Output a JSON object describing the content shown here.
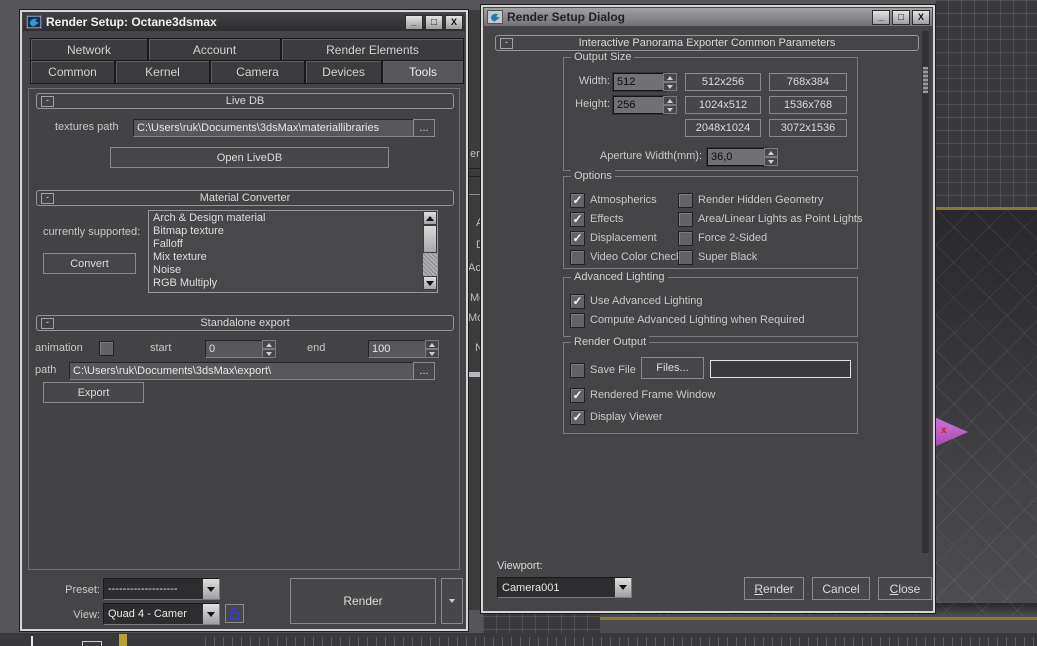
{
  "icons": {
    "minimize": "_",
    "maximize": "□",
    "close": "X",
    "collapse_minus": "-",
    "check": "✓",
    "gizmo_label": "x"
  },
  "colors": {
    "viewport_active_border": "#8c7a33",
    "gizmo_magenta": "#c45fc8",
    "lock_blue": "#3c3ccc",
    "dialog_bg": "#454547"
  },
  "left_dialog": {
    "title": "Render Setup: Octane3dsmax",
    "tabs_row1": [
      {
        "label": "Network"
      },
      {
        "label": "Account"
      },
      {
        "label": "Render Elements"
      }
    ],
    "tabs_row2": [
      {
        "label": "Common"
      },
      {
        "label": "Kernel"
      },
      {
        "label": "Camera"
      },
      {
        "label": "Devices"
      },
      {
        "label": "Tools"
      }
    ],
    "active_tab": "Tools",
    "live_db": {
      "title": "Live DB",
      "textures_path_label": "textures path",
      "textures_path_value": "C:\\Users\\ruk\\Documents\\3dsMax\\materiallibraries",
      "browse": "...",
      "open_button": "Open LiveDB"
    },
    "material_converter": {
      "title": "Material Converter",
      "supported_label": "currently supported:",
      "convert_button": "Convert",
      "items": [
        {
          "label": "Arch & Design material"
        },
        {
          "label": "Bitmap texture"
        },
        {
          "label": "Falloff"
        },
        {
          "label": "Mix texture"
        },
        {
          "label": "Noise"
        },
        {
          "label": "RGB Multiply"
        }
      ]
    },
    "standalone_export": {
      "title": "Standalone export",
      "animation_label": "animation",
      "start_label": "start",
      "start_value": "0",
      "end_label": "end",
      "end_value": "100",
      "path_label": "path",
      "path_value": "C:\\Users\\ruk\\Documents\\3dsMax\\export\\",
      "browse": "...",
      "export_button": "Export"
    },
    "footer": {
      "preset_label": "Preset:",
      "preset_value": "-------------------",
      "view_label": "View:",
      "view_value": "Quad 4 - Camer",
      "render_button": "Render"
    }
  },
  "right_dialog": {
    "title": "Render Setup Dialog",
    "rollup_title": "Interactive Panorama Exporter Common Parameters",
    "output_size": {
      "title": "Output Size",
      "width_label": "Width:",
      "width_value": "512",
      "height_label": "Height:",
      "height_value": "256",
      "aperture_label": "Aperture Width(mm):",
      "aperture_value": "36,0",
      "presets": [
        {
          "label": "512x256"
        },
        {
          "label": "768x384"
        },
        {
          "label": "1024x512"
        },
        {
          "label": "1536x768"
        },
        {
          "label": "2048x1024"
        },
        {
          "label": "3072x1536"
        }
      ]
    },
    "options": {
      "title": "Options",
      "left": [
        {
          "label": "Atmospherics",
          "check": "✓"
        },
        {
          "label": "Effects",
          "check": "✓"
        },
        {
          "label": "Displacement",
          "check": "✓"
        },
        {
          "label": "Video Color Check",
          "check": ""
        }
      ],
      "right": [
        {
          "label": "Render Hidden Geometry",
          "check": ""
        },
        {
          "label": "Area/Linear Lights as Point Lights",
          "check": ""
        },
        {
          "label": "Force 2-Sided",
          "check": ""
        },
        {
          "label": "Super Black",
          "check": ""
        }
      ]
    },
    "advanced_lighting": {
      "title": "Advanced Lighting",
      "items": [
        {
          "label": "Use Advanced Lighting",
          "check": "✓"
        },
        {
          "label": "Compute Advanced Lighting when Required",
          "check": ""
        }
      ]
    },
    "render_output": {
      "title": "Render Output",
      "save_file": {
        "label": "Save File",
        "check": ""
      },
      "files_button": "Files...",
      "output_field_value": "",
      "items": [
        {
          "label": "Rendered Frame Window",
          "check": "✓"
        },
        {
          "label": "Display Viewer",
          "check": "✓"
        }
      ]
    },
    "footer": {
      "viewport_label": "Viewport:",
      "viewport_value": "Camera001",
      "render_initial": "R",
      "render_rest": "ender",
      "cancel": "Cancel",
      "close_initial": "C",
      "close_rest": "lose"
    }
  },
  "background": {
    "fragments": [
      {
        "text": "er P"
      },
      {
        "text": "A"
      },
      {
        "text": "D"
      },
      {
        "text": "Act"
      },
      {
        "text": "Mo"
      },
      {
        "text": "Mov"
      },
      {
        "text": "N"
      }
    ]
  }
}
